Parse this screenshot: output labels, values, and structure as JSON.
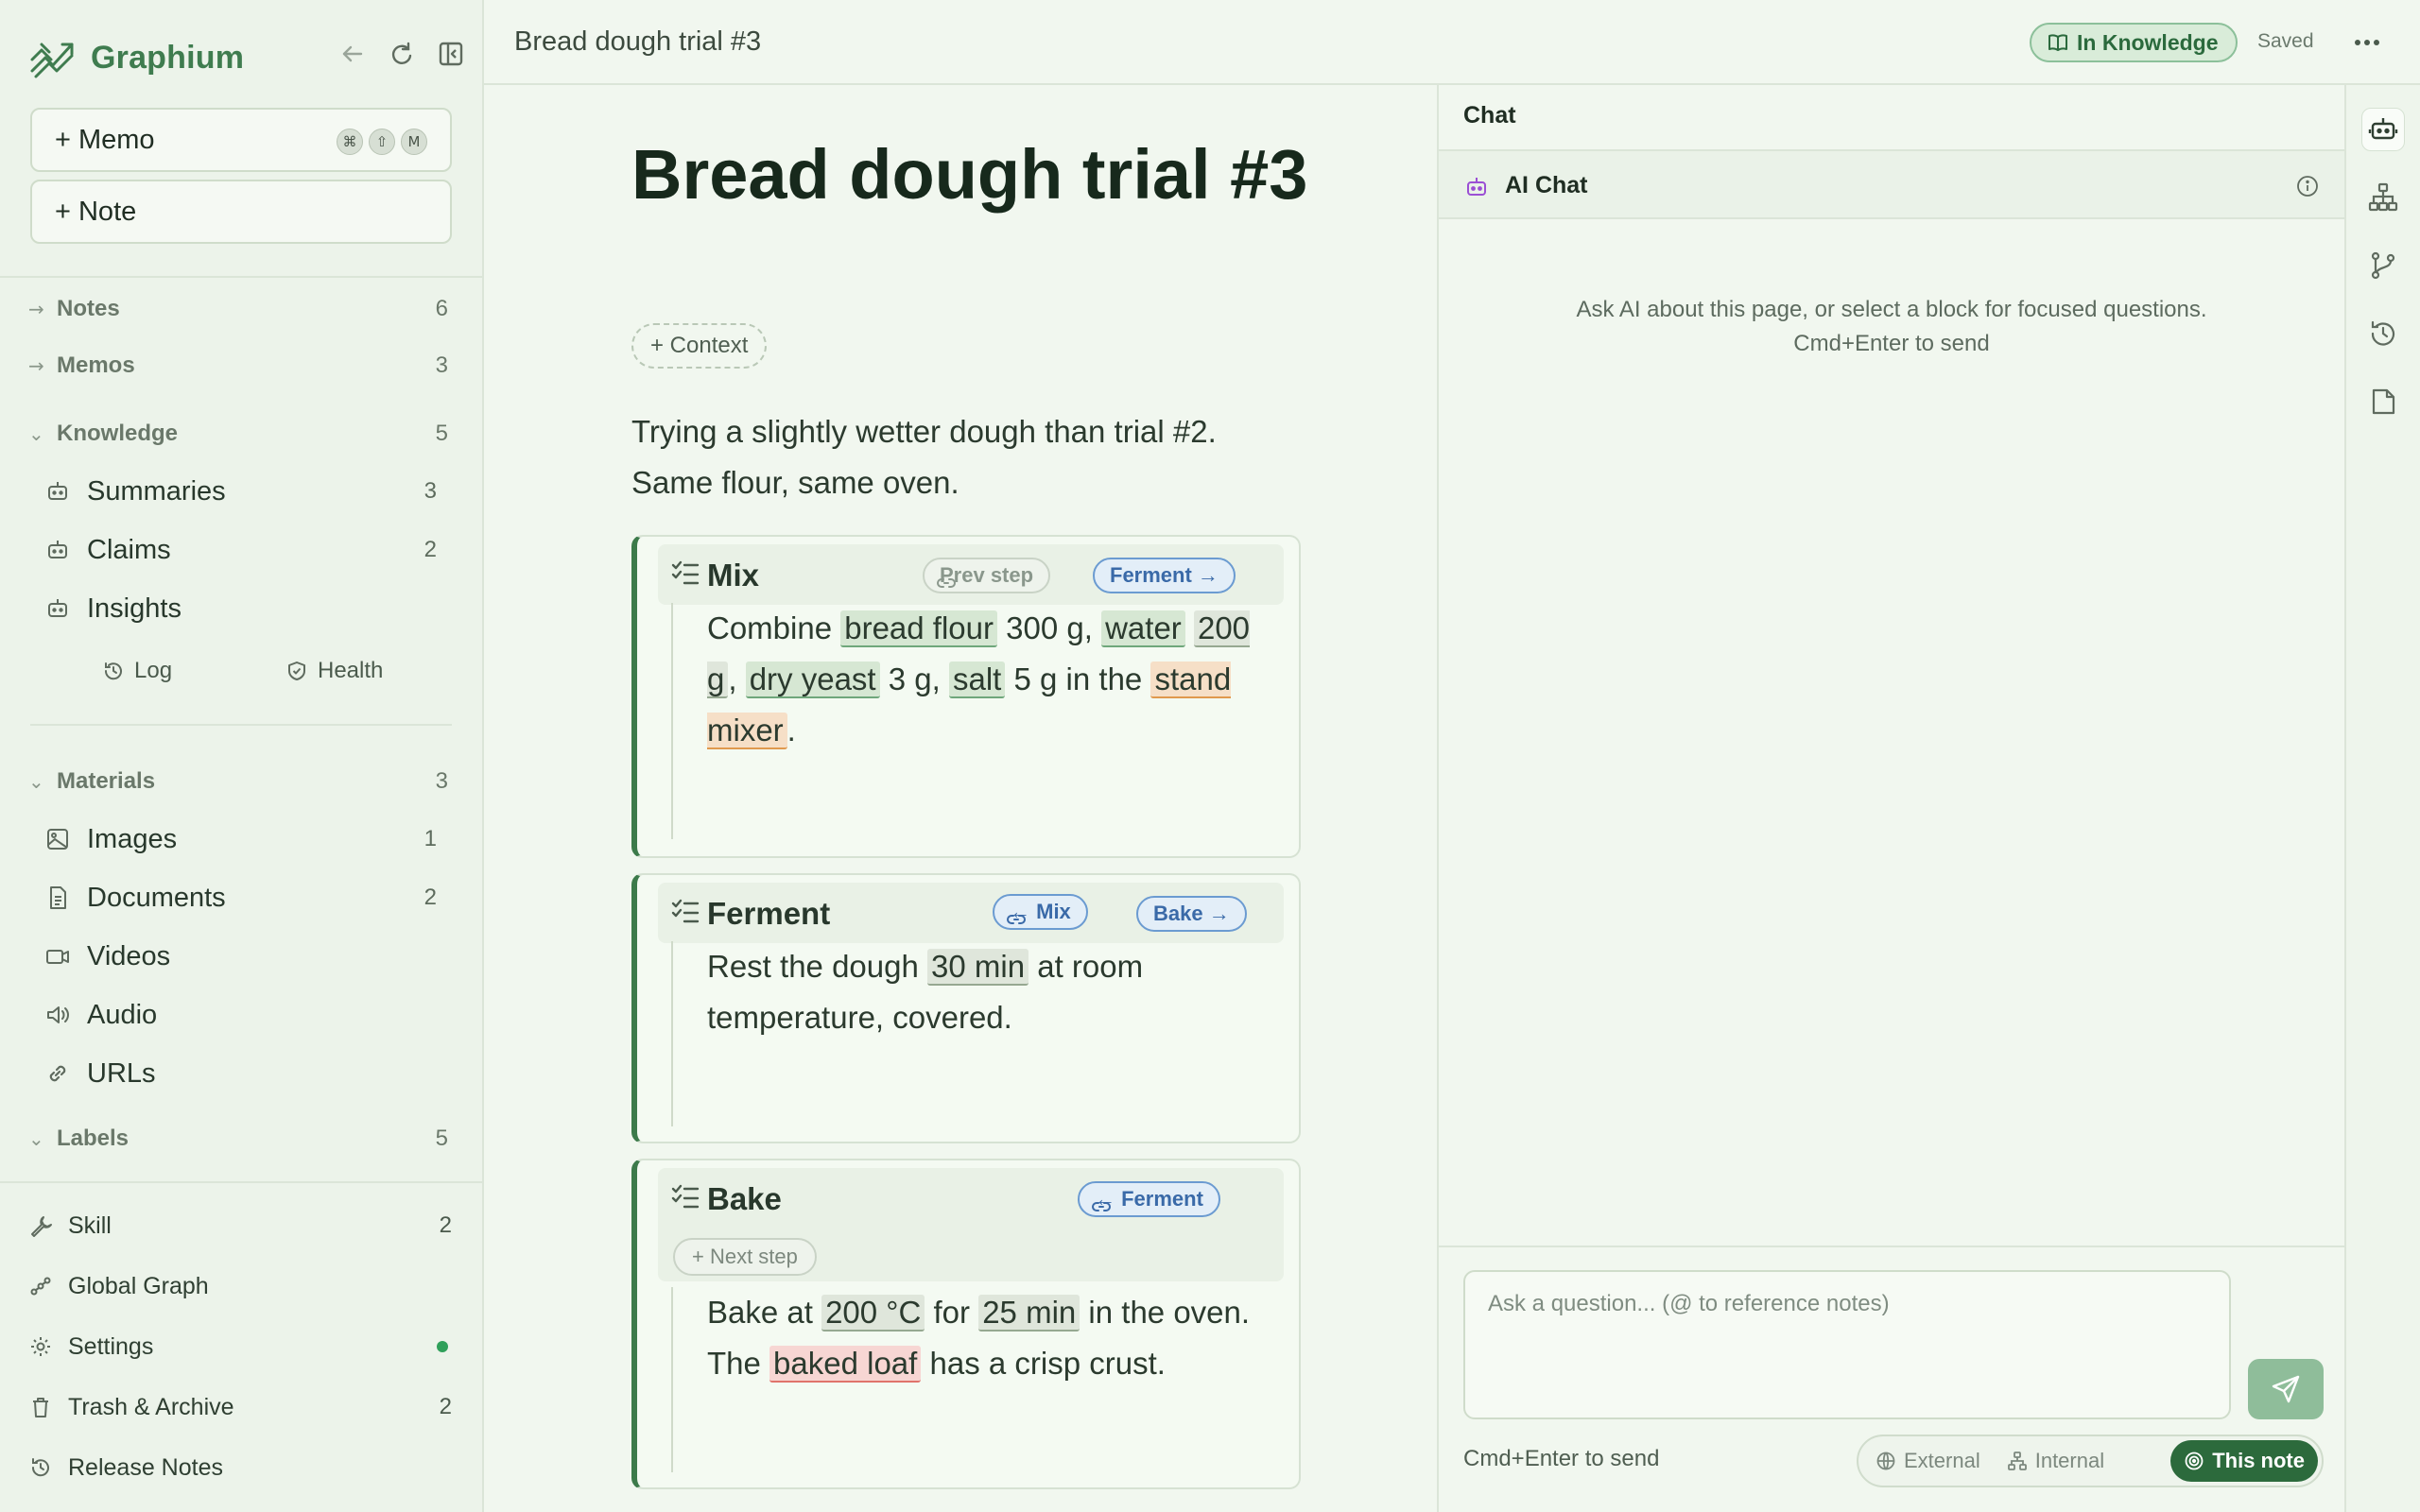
{
  "app": {
    "name": "Graphium"
  },
  "sidebar": {
    "create_memo": "+ Memo",
    "memo_shortcut": [
      "⌘",
      "⇧",
      "M"
    ],
    "create_note": "+ Note",
    "notes": {
      "label": "Notes",
      "count": "6"
    },
    "memos": {
      "label": "Memos",
      "count": "3"
    },
    "knowledge": {
      "label": "Knowledge",
      "count": "5",
      "items": [
        {
          "label": "Summaries",
          "count": "3"
        },
        {
          "label": "Claims",
          "count": "2"
        },
        {
          "label": "Insights",
          "count": ""
        }
      ],
      "log": "Log",
      "health": "Health"
    },
    "materials": {
      "label": "Materials",
      "count": "3",
      "items": [
        {
          "label": "Images",
          "count": "1"
        },
        {
          "label": "Documents",
          "count": "2"
        },
        {
          "label": "Videos",
          "count": ""
        },
        {
          "label": "Audio",
          "count": ""
        },
        {
          "label": "URLs",
          "count": ""
        }
      ]
    },
    "labels": {
      "label": "Labels",
      "count": "5"
    },
    "footer": [
      {
        "label": "Skill",
        "count": "2"
      },
      {
        "label": "Global Graph",
        "count": ""
      },
      {
        "label": "Settings",
        "count": ""
      },
      {
        "label": "Trash & Archive",
        "count": "2"
      },
      {
        "label": "Release Notes",
        "count": ""
      }
    ]
  },
  "header": {
    "doc_title": "Bread dough trial #3",
    "badge": "In Knowledge",
    "status": "Saved"
  },
  "editor": {
    "title": "Bread dough trial #3",
    "context_btn": "+ Context",
    "intro": "Trying a slightly wetter dough than trial #2. Same flour, same oven.",
    "steps": [
      {
        "title": "Mix",
        "links": [
          "Prev step",
          "Ferment →"
        ],
        "parts": [
          "Combine ",
          "bread flour",
          " 300 g, ",
          "water",
          " ",
          "200 g",
          ", ",
          "dry yeast",
          " 3 g, ",
          "salt",
          " 5 g in the ",
          "stand mixer",
          "."
        ]
      },
      {
        "title": "Ferment",
        "links": [
          "← Mix",
          "Bake →"
        ],
        "parts": [
          "Rest the dough ",
          "30 min",
          " at room temperature, covered."
        ]
      },
      {
        "title": "Bake",
        "links": [
          "← Ferment"
        ],
        "next_step": "+ Next step",
        "parts": [
          "Bake at ",
          "200 °C",
          " for ",
          "25 min",
          " in the oven. The ",
          "baked loaf",
          " has a crisp crust."
        ]
      }
    ]
  },
  "chat": {
    "title": "Chat",
    "tab": "AI Chat",
    "hint_line1": "Ask AI about this page, or select a block for focused questions.",
    "hint_line2": "Cmd+Enter to send",
    "placeholder": "Ask a question...  (@ to reference notes)",
    "footer_hint": "Cmd+Enter to send",
    "scopes": [
      "External",
      "Internal",
      "This note"
    ]
  },
  "colors": {
    "accent": "#2c6a3c",
    "brand": "#3f7c4f",
    "link_blue": "#3a6aa8"
  }
}
